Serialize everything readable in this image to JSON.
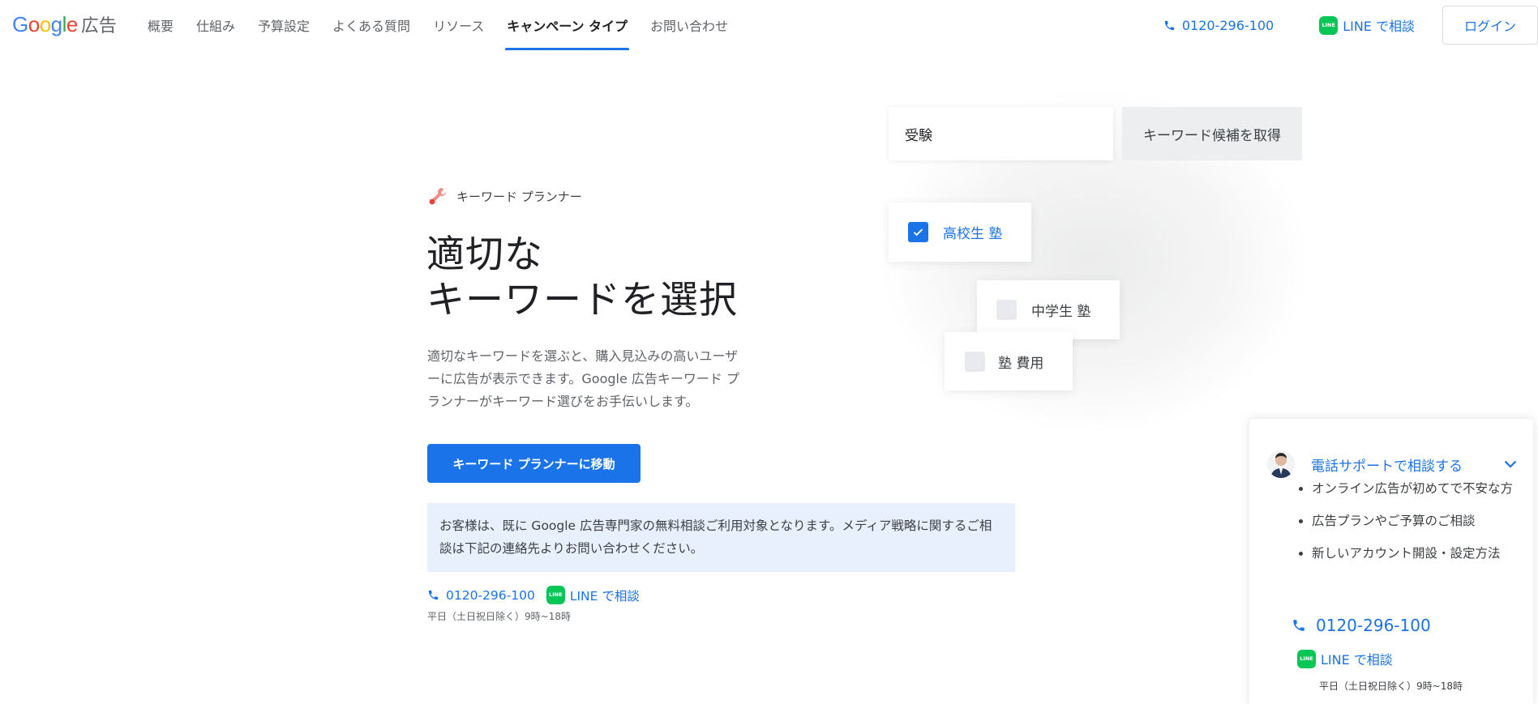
{
  "header": {
    "logo_text": "Google",
    "logo_suffix": "広告",
    "nav": [
      {
        "label": "概要",
        "active": false
      },
      {
        "label": "仕組み",
        "active": false
      },
      {
        "label": "予算設定",
        "active": false
      },
      {
        "label": "よくある質問",
        "active": false
      },
      {
        "label": "リソース",
        "active": false
      },
      {
        "label": "キャンペーン タイプ",
        "active": true
      },
      {
        "label": "お問い合わせ",
        "active": false
      }
    ],
    "phone": "0120-296-100",
    "line_label": "LINE で相談",
    "line_icon_text": "LINE",
    "login": "ログイン"
  },
  "hero": {
    "eyebrow": "キーワード プランナー",
    "title_line1": "適切な",
    "title_line2": "キーワードを選択",
    "description": "適切なキーワードを選ぶと、購入見込みの高いユーザーに広告が表示できます。Google 広告キーワード プランナーがキーワード選びをお手伝いします。",
    "cta": "キーワード プランナーに移動",
    "notice": "お客様は、既に Google 広告専門家の無料相談ご利用対象となります。メディア戦略に関するご相談は下記の連絡先よりお問い合わせください。",
    "phone": "0120-296-100",
    "line_label": "LINE で相談",
    "hours": "平日（土日祝日除く）9時~18時"
  },
  "mock": {
    "input_value": "受験",
    "button": "キーワード候補を取得",
    "keywords": [
      {
        "label": "高校生 塾",
        "checked": true
      },
      {
        "label": "中学生 塾",
        "checked": false
      },
      {
        "label": "塾 費用",
        "checked": false
      }
    ]
  },
  "support": {
    "title": "電話サポートで相談する",
    "bullets": [
      "オンライン広告が初めてで不安な方",
      "広告プランやご予算のご相談",
      "新しいアカウント開設・設定方法"
    ],
    "phone": "0120-296-100",
    "line_label": "LINE で相談",
    "hours": "平日（土日祝日除く）9時~18時"
  },
  "colors": {
    "accent": "#1a73e8",
    "line_green": "#06c755",
    "notice_bg": "#e8f0fe"
  }
}
